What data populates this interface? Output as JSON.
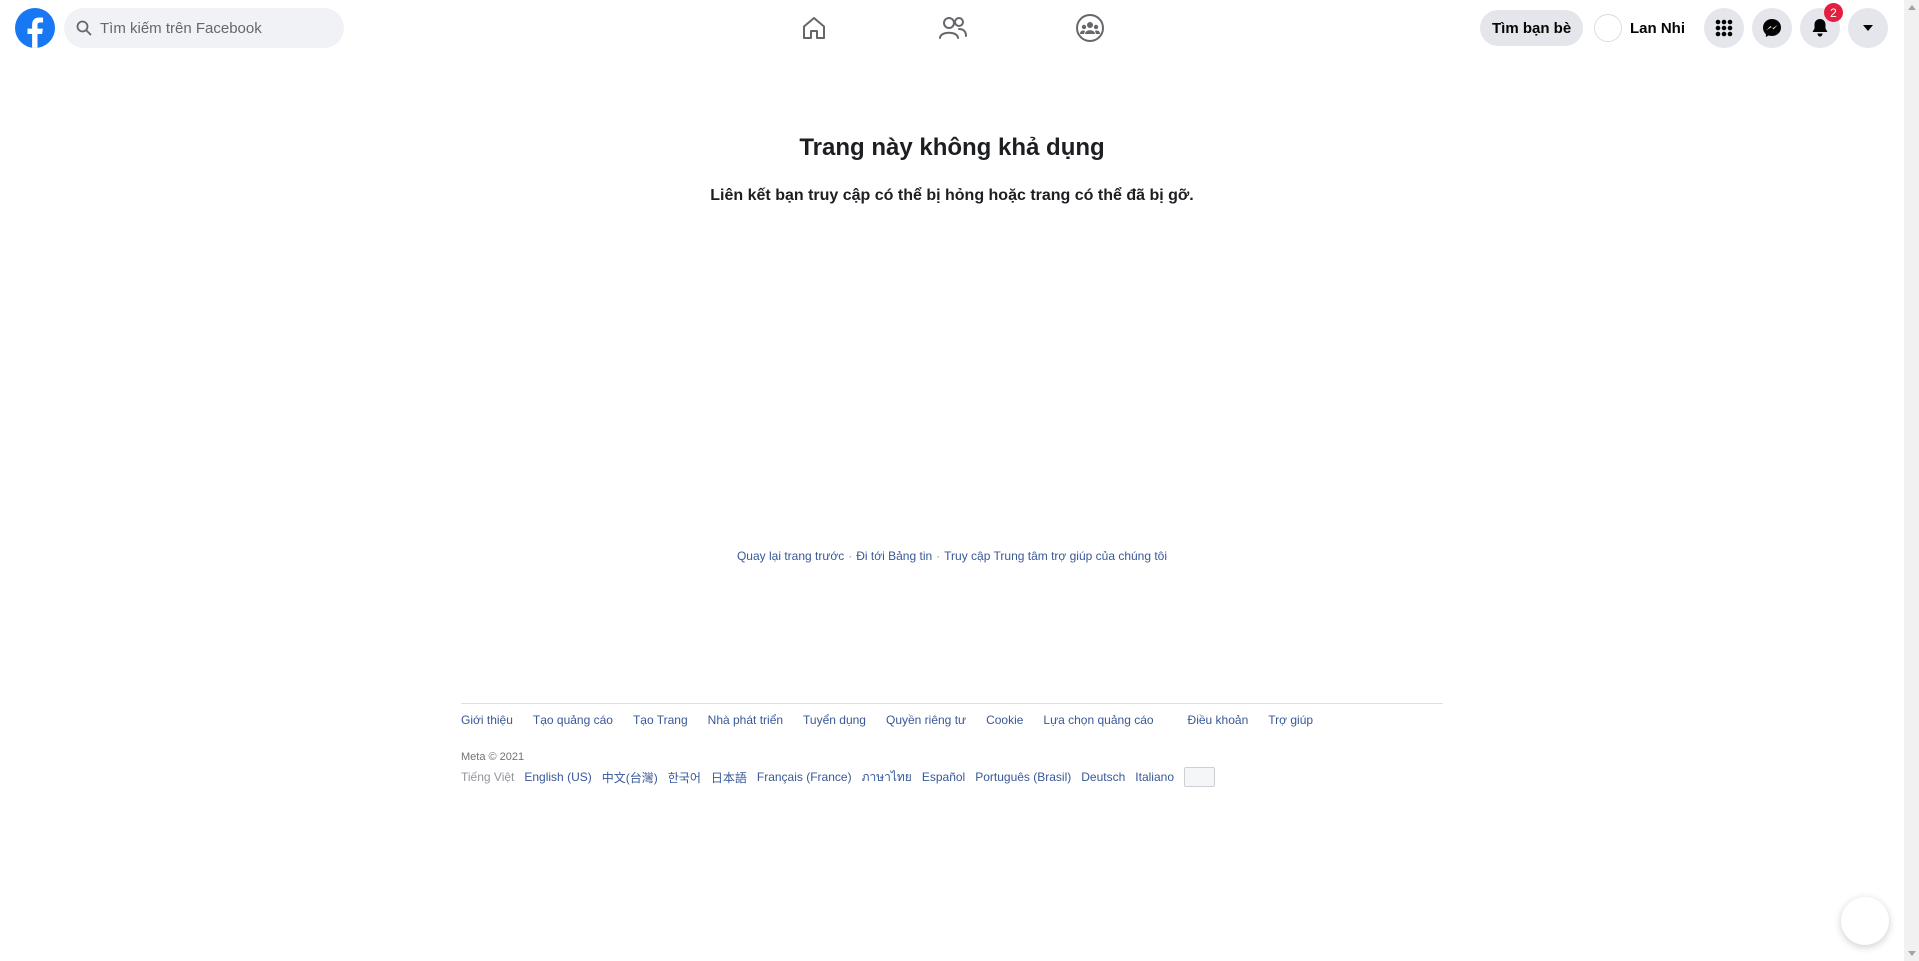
{
  "header": {
    "search_placeholder": "Tìm kiếm trên Facebook",
    "find_friends_label": "Tìm bạn bè",
    "profile_name": "Lan Nhi",
    "notifications_count": "2",
    "brand_color": "#1877f2"
  },
  "main": {
    "title": "Trang này không khả dụng",
    "subtitle": "Liên kết bạn truy cập có thể bị hỏng hoặc trang có thể đã bị gỡ."
  },
  "help_links": {
    "back": "Quay lại trang trước",
    "sep": "·",
    "news_feed": "Đi tới Bảng tin",
    "help_center": "Truy cập Trung tâm trợ giúp của chúng tôi"
  },
  "footer": {
    "links": [
      "Giới thiệu",
      "Tạo quảng cáo",
      "Tạo Trang",
      "Nhà phát triển",
      "Tuyển dụng",
      "Quyền riêng tư",
      "Cookie",
      "Lựa chọn quảng cáo",
      "Điều khoản",
      "Trợ giúp"
    ],
    "copyright": "Meta © 2021",
    "current_language": "Tiếng Việt",
    "languages": [
      "English (US)",
      "中文(台灣)",
      "한국어",
      "日本語",
      "Français (France)",
      "ภาษาไทย",
      "Español",
      "Português (Brasil)",
      "Deutsch",
      "Italiano"
    ]
  }
}
